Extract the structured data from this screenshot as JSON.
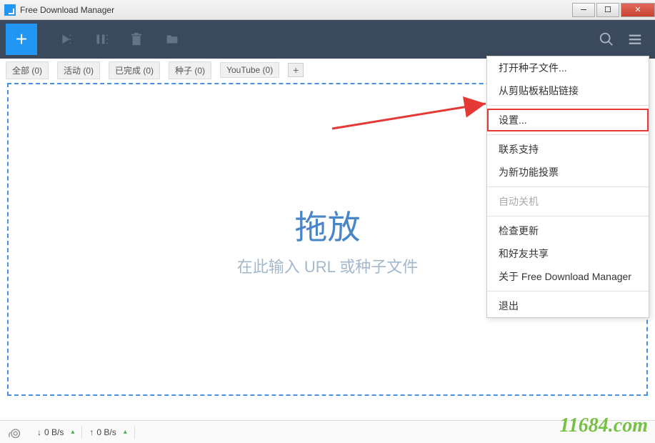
{
  "window": {
    "title": "Free Download Manager"
  },
  "filters": {
    "all": "全部 (0)",
    "active": "活动 (0)",
    "completed": "已完成 (0)",
    "seeds": "种子 (0)",
    "youtube": "YouTube (0)"
  },
  "dropzone": {
    "title": "拖放",
    "subtitle": "在此输入 URL 或种子文件"
  },
  "menu": {
    "open_torrent": "打开种子文件...",
    "paste_clipboard": "从剪贴板粘贴链接",
    "settings": "设置...",
    "contact_support": "联系支持",
    "vote_features": "为新功能投票",
    "auto_shutdown": "自动关机",
    "check_updates": "检查更新",
    "share_friends": "和好友共享",
    "about": "关于 Free Download Manager",
    "exit": "退出"
  },
  "status": {
    "download_speed": "0 B/s",
    "upload_speed": "0 B/s"
  },
  "watermark": "11684.com"
}
